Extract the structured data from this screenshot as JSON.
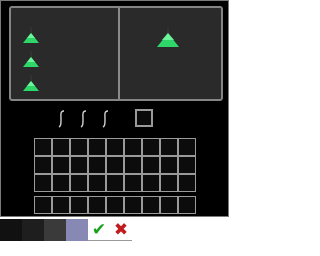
{
  "window": {
    "background": "#000000",
    "border_color": "#7a7a7a"
  },
  "preview": {
    "background": "#2a2a2a",
    "small_trees": [
      {
        "icon": "green-cone-tree-icon"
      },
      {
        "icon": "green-cone-tree-icon"
      },
      {
        "icon": "green-cone-tree-icon"
      }
    ],
    "large_tree": {
      "icon": "green-cone-tree-icon"
    },
    "tree_color": "#2fd76b"
  },
  "tool_row": {
    "hooks": [
      {
        "icon": "hook-icon"
      },
      {
        "icon": "hook-icon"
      },
      {
        "icon": "hook-icon"
      }
    ],
    "result_slot": {
      "icon": "empty-slot"
    }
  },
  "inventory": {
    "rows": 3,
    "columns": 9,
    "hotbar_columns": 9
  },
  "bottom_bar": {
    "swatches": [
      {
        "name": "black",
        "color": "#111111"
      },
      {
        "name": "dark-gray-1",
        "color": "#1e1e1e"
      },
      {
        "name": "dark-gray-2",
        "color": "#3a3a3a"
      },
      {
        "name": "slate-blue",
        "color": "#8888b5"
      }
    ],
    "confirm_symbol": "✔",
    "cancel_symbol": "✖"
  }
}
